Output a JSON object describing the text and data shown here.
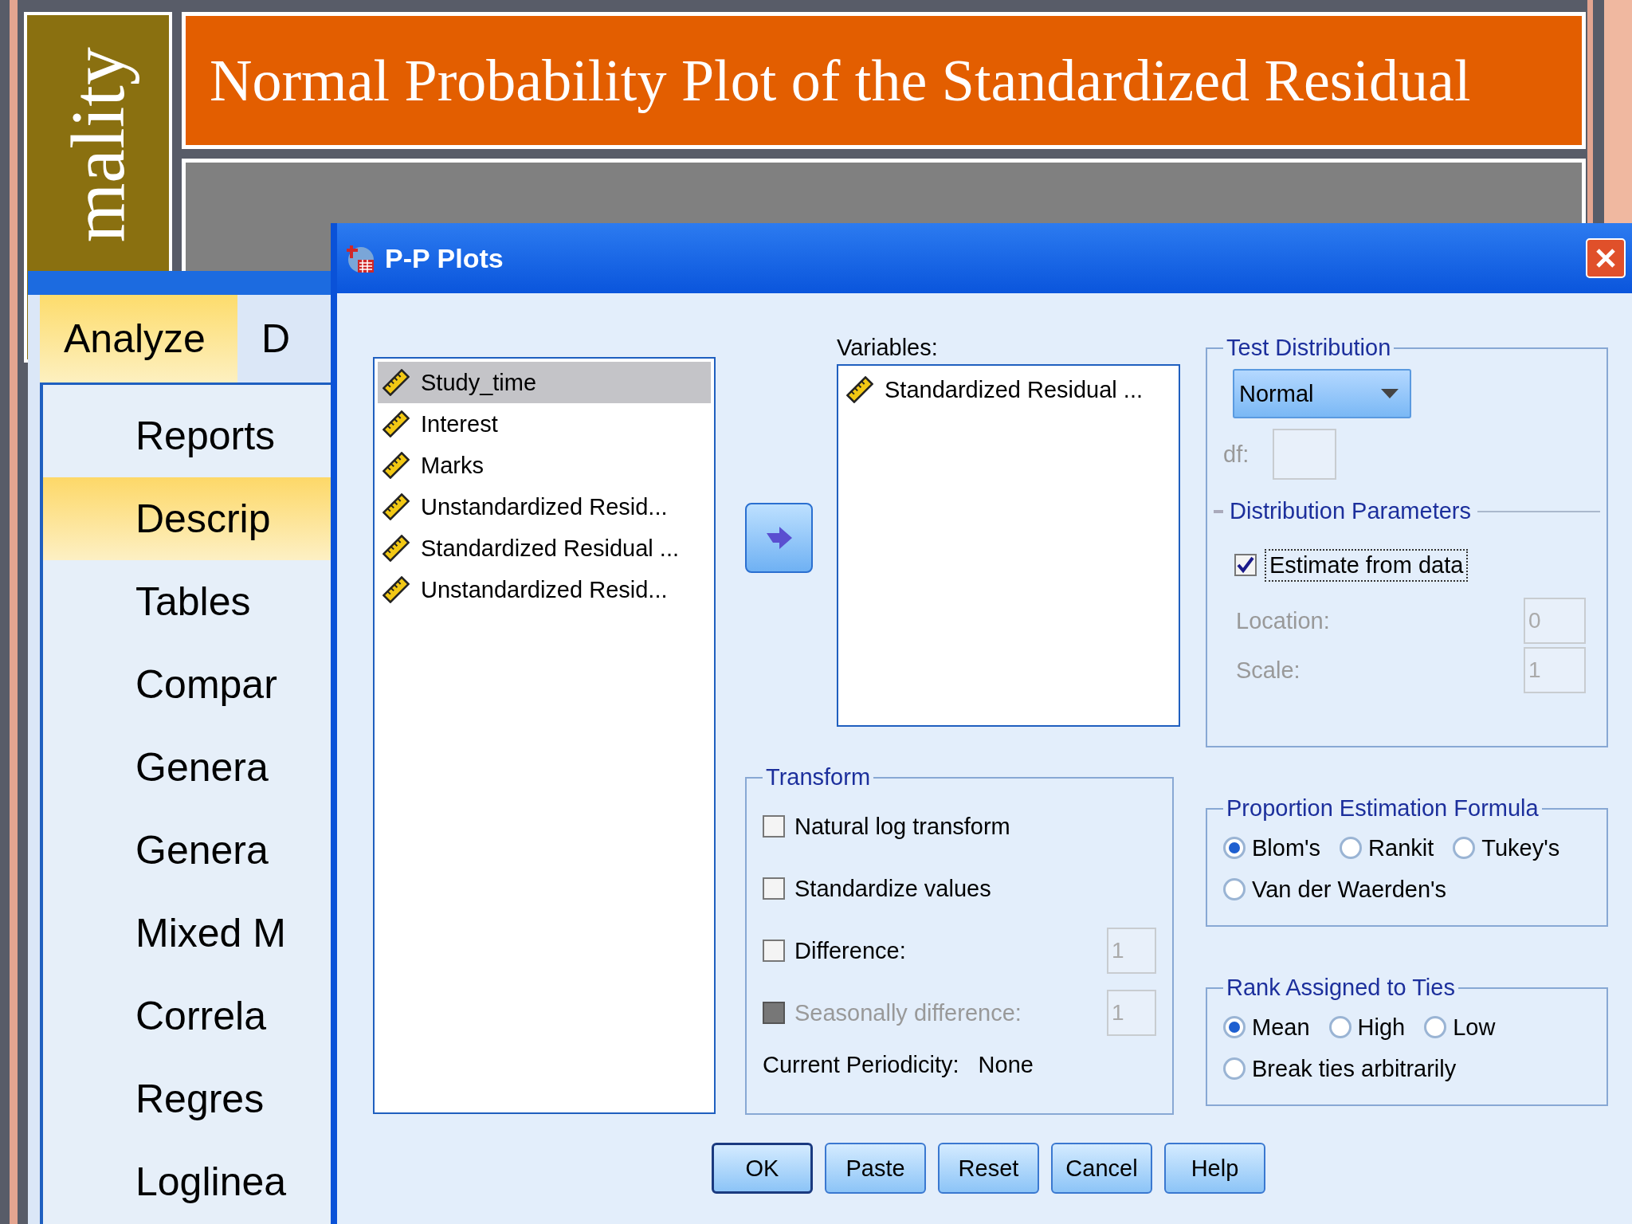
{
  "slide": {
    "section_title": "mality",
    "title": "Normal Probability Plot of the Standardized Residual"
  },
  "app_menu": {
    "menubar": [
      {
        "label": "Analyze",
        "selected": true
      },
      {
        "label": "D",
        "selected": false
      }
    ],
    "items": [
      {
        "label": "Reports",
        "selected": false
      },
      {
        "label": "Descrip",
        "selected": true
      },
      {
        "label": "Tables",
        "selected": false
      },
      {
        "label": "Compar",
        "selected": false
      },
      {
        "label": "Genera",
        "selected": false
      },
      {
        "label": "Genera",
        "selected": false
      },
      {
        "label": "Mixed M",
        "selected": false
      },
      {
        "label": "Correla",
        "selected": false
      },
      {
        "label": "Regres",
        "selected": false
      },
      {
        "label": "Loglinea",
        "selected": false
      }
    ]
  },
  "dialog": {
    "title": "P-P Plots",
    "source_variables": [
      {
        "name": "Study_time",
        "selected": true
      },
      {
        "name": "Interest",
        "selected": false
      },
      {
        "name": "Marks",
        "selected": false
      },
      {
        "name": "Unstandardized Resid...",
        "selected": false
      },
      {
        "name": "Standardized Residual ...",
        "selected": false
      },
      {
        "name": "Unstandardized Resid...",
        "selected": false
      }
    ],
    "variables_label": "Variables:",
    "target_variables": [
      {
        "name": "Standardized Residual ..."
      }
    ],
    "test_distribution": {
      "legend": "Test Distribution",
      "distribution": "Normal",
      "df": {
        "label": "df:",
        "disabled": true
      },
      "parameters_legend": "Distribution Parameters",
      "estimate": {
        "label": "Estimate from data",
        "checked": true
      },
      "location": {
        "label": "Location:",
        "value": "0",
        "disabled": true
      },
      "scale": {
        "label": "Scale:",
        "value": "1",
        "disabled": true
      }
    },
    "transform": {
      "legend": "Transform",
      "options": [
        {
          "label": "Natural log transform",
          "checked": false,
          "disabled": false
        },
        {
          "label": "Standardize values",
          "checked": false,
          "disabled": false
        },
        {
          "label": "Difference:",
          "checked": false,
          "disabled": false,
          "value": "1"
        },
        {
          "label": "Seasonally difference:",
          "checked": false,
          "disabled": true,
          "value": "1"
        }
      ],
      "periodicity_label": "Current Periodicity:",
      "periodicity_value": "None"
    },
    "proportion": {
      "legend": "Proportion Estimation Formula",
      "options": [
        {
          "label": "Blom's",
          "selected": true
        },
        {
          "label": "Rankit",
          "selected": false
        },
        {
          "label": "Tukey's",
          "selected": false
        },
        {
          "label": "Van der Waerden's",
          "selected": false
        }
      ]
    },
    "rank": {
      "legend": "Rank Assigned to Ties",
      "options": [
        {
          "label": "Mean",
          "selected": true
        },
        {
          "label": "High",
          "selected": false
        },
        {
          "label": "Low",
          "selected": false
        },
        {
          "label": "Break ties arbitrarily",
          "selected": false
        }
      ]
    },
    "buttons": [
      {
        "label": "OK",
        "default": true
      },
      {
        "label": "Paste",
        "default": false
      },
      {
        "label": "Reset",
        "default": false
      },
      {
        "label": "Cancel",
        "default": false
      },
      {
        "label": "Help",
        "default": false
      }
    ]
  }
}
